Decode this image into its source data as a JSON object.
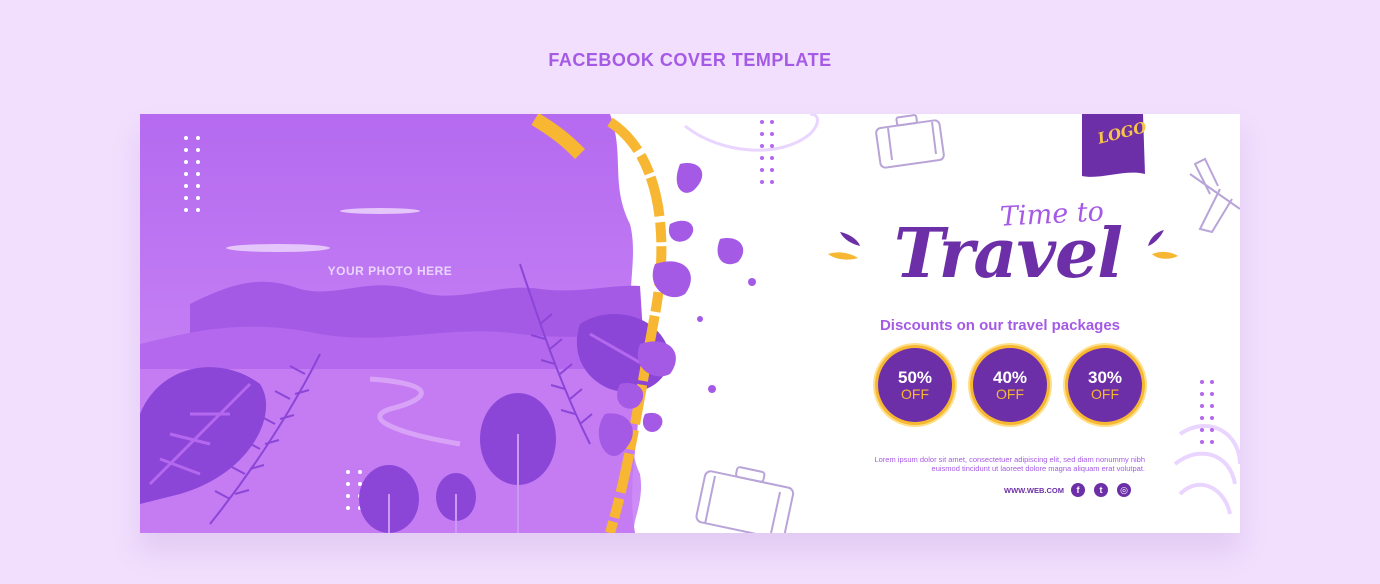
{
  "page_title": "FACEBOOK COVER TEMPLATE",
  "cover": {
    "photo_placeholder": "YOUR PHOTO HERE",
    "logo_text": "LOGO",
    "title_small": "Time to",
    "title_large": "Travel",
    "subheading": "Discounts on our travel packages",
    "discounts": [
      {
        "value": "50%",
        "label": "OFF"
      },
      {
        "value": "40%",
        "label": "OFF"
      },
      {
        "value": "30%",
        "label": "OFF"
      }
    ],
    "body_text": "Lorem ipsum dolor sit amet, consectetuer adipiscing elit, sed diam nonummy nibh euismod tincidunt ut laoreet dolore magna aliquam erat volutpat.",
    "website": "WWW.WEB.COM",
    "social_icons": [
      "facebook-icon",
      "twitter-icon",
      "instagram-icon"
    ]
  },
  "colors": {
    "background": "#f1dffd",
    "accent_purple": "#a55ae6",
    "deep_purple": "#6d2fa8",
    "yellow": "#f7b732",
    "white": "#ffffff"
  }
}
